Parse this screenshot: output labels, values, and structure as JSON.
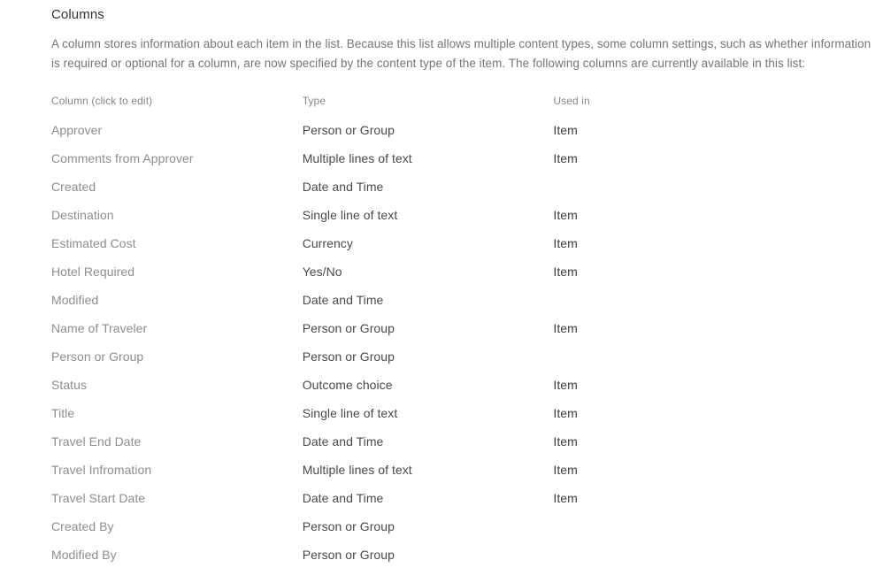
{
  "section": {
    "title": "Columns",
    "description": "A column stores information about each item in the list. Because this list allows multiple content types, some column settings, such as whether information is required or optional for a column, are now specified by the content type of the item. The following columns are currently available in this list:"
  },
  "table": {
    "headers": {
      "name": "Column (click to edit)",
      "type": "Type",
      "used_in": "Used in"
    },
    "rows": [
      {
        "name": "Approver",
        "type": "Person or Group",
        "used_in": "Item"
      },
      {
        "name": "Comments from Approver",
        "type": "Multiple lines of text",
        "used_in": "Item"
      },
      {
        "name": "Created",
        "type": "Date and Time",
        "used_in": ""
      },
      {
        "name": "Destination",
        "type": "Single line of text",
        "used_in": "Item"
      },
      {
        "name": "Estimated Cost",
        "type": "Currency",
        "used_in": "Item"
      },
      {
        "name": "Hotel Required",
        "type": "Yes/No",
        "used_in": "Item"
      },
      {
        "name": "Modified",
        "type": "Date and Time",
        "used_in": ""
      },
      {
        "name": "Name of Traveler",
        "type": "Person or Group",
        "used_in": "Item"
      },
      {
        "name": "Person or Group",
        "type": "Person or Group",
        "used_in": ""
      },
      {
        "name": "Status",
        "type": "Outcome choice",
        "used_in": "Item"
      },
      {
        "name": "Title",
        "type": "Single line of text",
        "used_in": "Item"
      },
      {
        "name": "Travel End Date",
        "type": "Date and Time",
        "used_in": "Item"
      },
      {
        "name": "Travel Infromation",
        "type": "Multiple lines of text",
        "used_in": "Item"
      },
      {
        "name": "Travel Start Date",
        "type": "Date and Time",
        "used_in": "Item"
      },
      {
        "name": "Created By",
        "type": "Person or Group",
        "used_in": ""
      },
      {
        "name": "Modified By",
        "type": "Person or Group",
        "used_in": ""
      }
    ]
  },
  "colors": {
    "background": "#ffffff",
    "title_text": "#333333",
    "body_text": "#767676",
    "header_text": "#8a8886",
    "column_name_text": "#8e8e8e",
    "type_text": "#4a4a4a",
    "used_in_text": "#3b3b3b"
  }
}
